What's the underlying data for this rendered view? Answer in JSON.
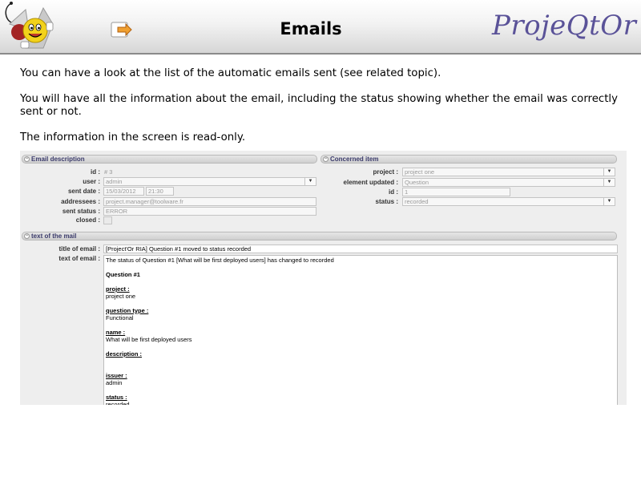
{
  "header": {
    "title": "Emails",
    "brand": "ProjeQtOr",
    "logo_icon": "projeqtor-mascot-logo",
    "nav_icon": "return-arrow-icon"
  },
  "content": {
    "para1": "You can have a look at the list of the automatic emails sent (see related topic).",
    "para2": "You will have all the information about the email, including the status showing whether the email was correctly sent or not.",
    "para3": "The information in the screen is read-only."
  },
  "email_description": {
    "section_title": "Email description",
    "id_label": "id :",
    "id_value": "# 3",
    "user_label": "user :",
    "user_value": "admin",
    "sent_date_label": "sent date :",
    "sent_date_value": "15/03/2012",
    "sent_time_value": "21:30",
    "addressees_label": "addressees :",
    "addressees_value": "project.manager@toolware.fr",
    "sent_status_label": "sent status :",
    "sent_status_value": "ERROR",
    "closed_label": "closed :"
  },
  "concerned_item": {
    "section_title": "Concerned item",
    "project_label": "project :",
    "project_value": "project one",
    "element_label": "element updated :",
    "element_value": "Question",
    "id_label": "id :",
    "id_value": "1",
    "status_label": "status :",
    "status_value": "recorded"
  },
  "mail": {
    "section_title": "text of the mail",
    "title_label": "title of email :",
    "title_value": "[Project'Or RIA] Question #1 moved to status recorded",
    "text_label": "text of email :",
    "line1": "The status of Question #1 [What will be first deployed users] has changed to recorded",
    "heading": "Question #1",
    "project_h": "project :",
    "project_v": "project one",
    "qtype_h": "question type :",
    "qtype_v": "Functional",
    "name_h": "name :",
    "name_v": "What will be first deployed users",
    "desc_h": "description :",
    "issuer_h": "issuer :",
    "issuer_v": "admin",
    "status_h": "status :",
    "status_v": "recorded"
  },
  "colors": {
    "brand": "#5a5298",
    "section_text": "#3b3b6b"
  }
}
